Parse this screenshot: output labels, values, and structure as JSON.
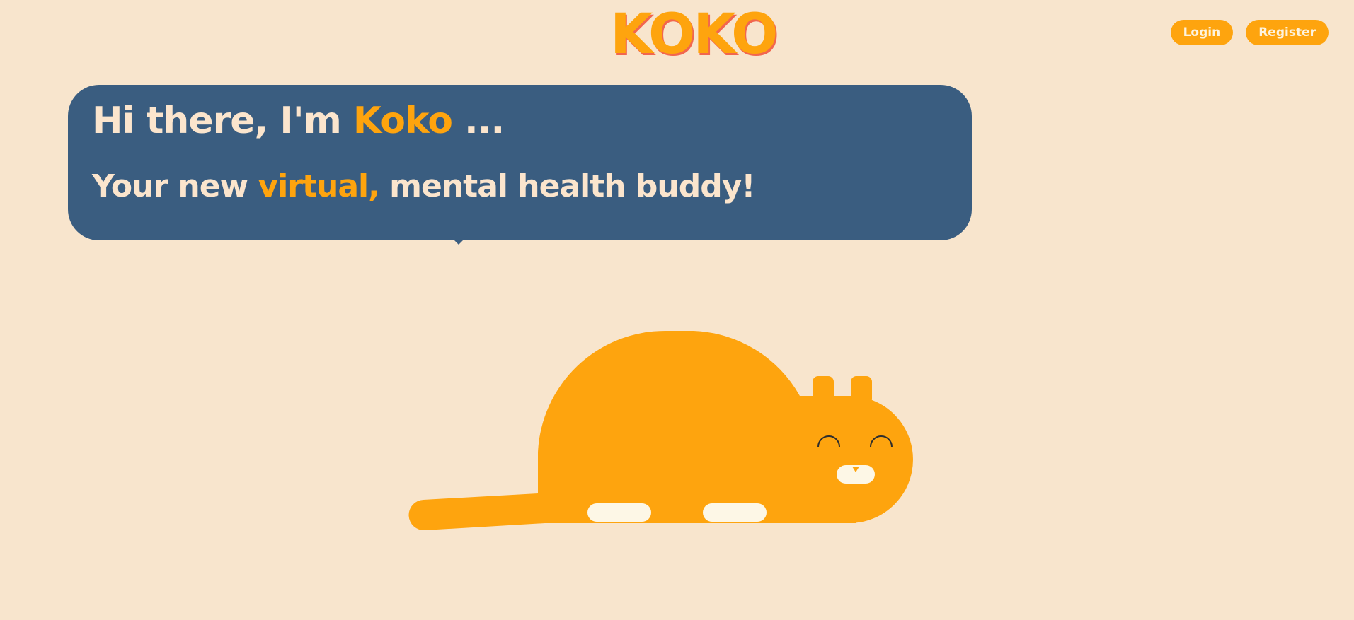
{
  "header": {
    "logo_text": "KOKO",
    "login_label": "Login",
    "register_label": "Register"
  },
  "hero": {
    "greeting_prefix": "Hi there, I'm ",
    "greeting_name": "Koko",
    "greeting_suffix": " ...",
    "tagline_prefix": "Your new ",
    "tagline_accent": "virtual,",
    "tagline_suffix": " mental health buddy!"
  },
  "colors": {
    "background": "#f8e5cd",
    "accent": "#fea40e",
    "bubble": "#3a5d80",
    "logo_shadow": "#f2664e",
    "paws": "#fdf7e6"
  },
  "illustration": {
    "name": "koko-cat-mascot"
  }
}
